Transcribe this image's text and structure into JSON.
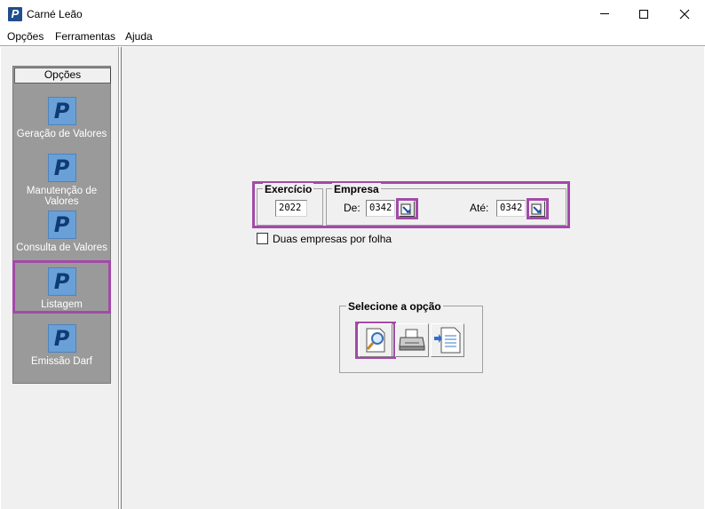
{
  "window": {
    "title": "Carné Leão",
    "icon": "p-logo-icon"
  },
  "menu": {
    "items": [
      "Opções",
      "Ferramentas",
      "Ajuda"
    ]
  },
  "sidebar": {
    "header": "Opções",
    "items": [
      {
        "label": "Geração de Valores",
        "icon": "p-logo-icon"
      },
      {
        "label": "Manutenção de Valores",
        "icon": "p-logo-icon"
      },
      {
        "label": "Consulta de Valores",
        "icon": "p-logo-icon"
      },
      {
        "label": "Listagem",
        "icon": "p-logo-icon",
        "selected": true
      },
      {
        "label": "Emissão Darf",
        "icon": "p-logo-icon"
      }
    ]
  },
  "form": {
    "exercicio": {
      "legend": "Exercício",
      "value": "2022"
    },
    "empresa": {
      "legend": "Empresa",
      "de_label": "De:",
      "de_value": "0342",
      "ate_label": "Até:",
      "ate_value": "0342"
    },
    "duas_empresas": {
      "label": "Duas empresas por folha",
      "checked": false
    },
    "opcao": {
      "legend": "Selecione a opção",
      "buttons": [
        "preview-magnifier-icon",
        "printer-icon",
        "export-file-icon"
      ]
    }
  },
  "colors": {
    "highlight": "#a24aa8",
    "sidebar_bg": "#9a9a9a",
    "icon_bg": "#6aa0d8"
  }
}
